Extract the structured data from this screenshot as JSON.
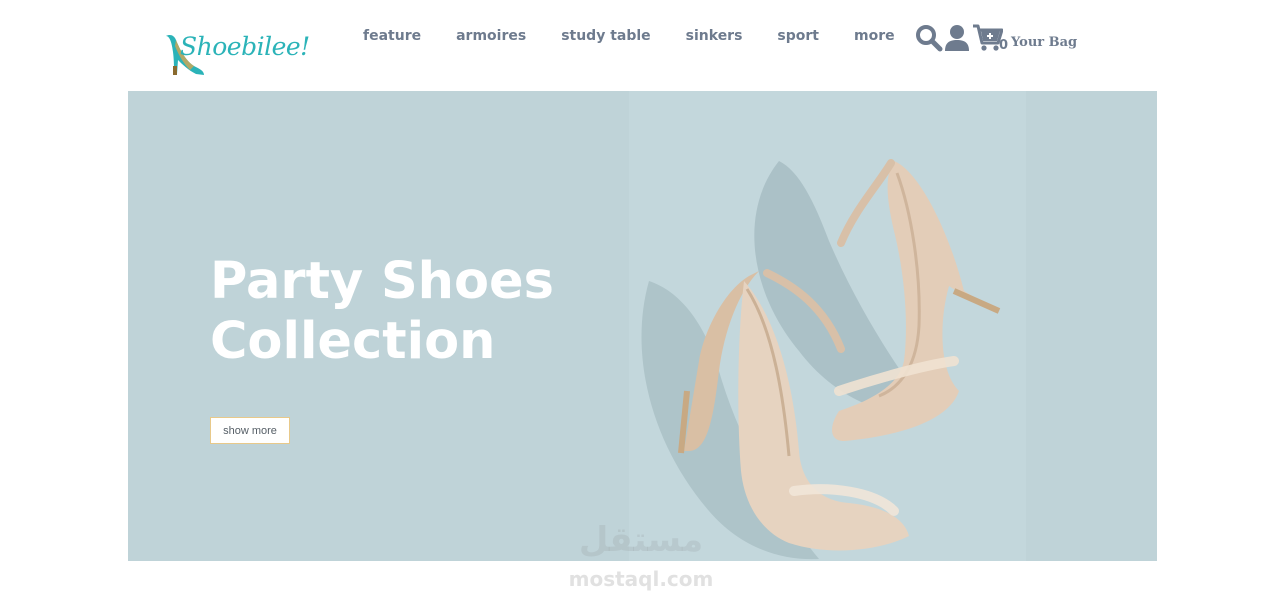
{
  "brand": {
    "name": "Shoebilee!",
    "logo_icon": "high-heel-shoe-icon",
    "accent": "#2bb3b8"
  },
  "nav": {
    "items": [
      {
        "label": "feature"
      },
      {
        "label": "armoires"
      },
      {
        "label": "study table"
      },
      {
        "label": "sinkers"
      },
      {
        "label": "sport"
      },
      {
        "label": "more"
      }
    ]
  },
  "header_icons": {
    "search": "search-icon",
    "user": "user-icon",
    "cart": "cart-plus-icon",
    "cart_count": "0",
    "bag_label": "Your Bag"
  },
  "hero": {
    "title_line1": "Party Shoes",
    "title_line2": "Collection",
    "button_label": "show more",
    "background": "#bfd3d8",
    "image": "rhinestone-high-heel-sandals-photo"
  },
  "watermark": {
    "arabic": "مستقل",
    "latin": "mostaql.com"
  }
}
